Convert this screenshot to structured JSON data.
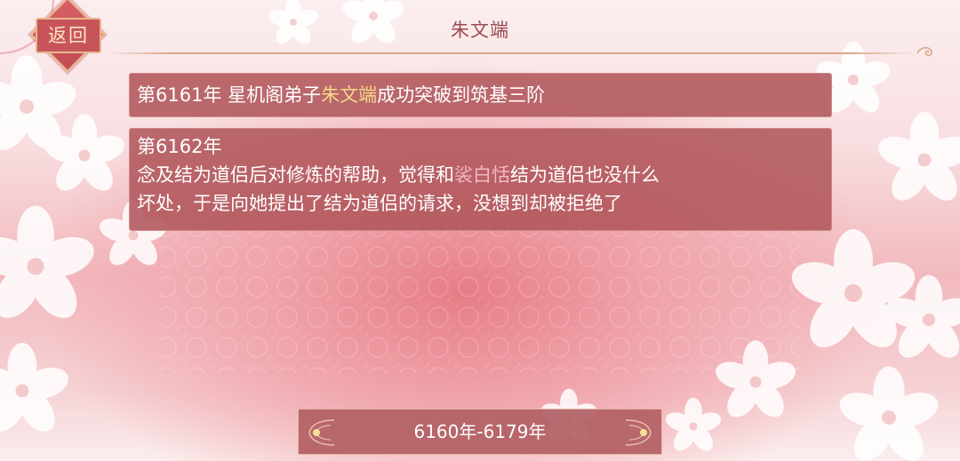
{
  "header": {
    "back_label": "返回",
    "title": "朱文端"
  },
  "events": [
    {
      "prefix": "第6161年  星机阁弟子",
      "highlight": "朱文端",
      "suffix": "成功突破到筑基三阶"
    },
    {
      "year": "第6162年",
      "line1_before": "念及结为道侣后对修炼的帮助，觉得和",
      "highlight": "裟白恬",
      "line1_after": "结为道侣也没什么",
      "line2": "坏处，于是向她提出了结为道侣的请求，没想到却被拒绝了"
    }
  ],
  "footer": {
    "range_label": "6160年-6179年"
  },
  "colors": {
    "card_bg": "#b0565b",
    "highlight_gold": "#f5d98a",
    "highlight_pink": "#f2b8c4",
    "title_text": "#9b4b4f",
    "back_button": "#c8545b"
  }
}
